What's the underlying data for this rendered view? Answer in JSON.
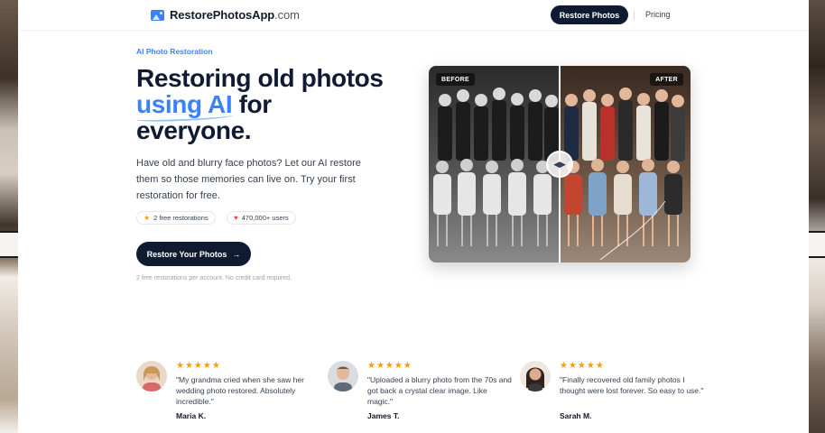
{
  "header": {
    "logo_name": "RestorePhotosApp",
    "logo_domain": ".com",
    "logo_icon": "photo-icon",
    "nav_button": "Restore Photos",
    "nav_link": "Pricing"
  },
  "hero": {
    "eyebrow": "AI Photo Restoration",
    "headline_line1": "Restoring old photos",
    "headline_accent": "using AI",
    "headline_line2_rest": " for",
    "headline_line3": "everyone.",
    "description": "Have old and blurry face photos? Let our AI restore them so those memories can live on. Try your first restoration for free.",
    "badge_restorations": "2 free restorations",
    "badge_users": "470,000+ users",
    "cta_label": "Restore Your Photos",
    "cta_arrow": "→",
    "fineprint": "2 free restorations per account. No credit card required."
  },
  "compare": {
    "before_label": "BEFORE",
    "after_label": "AFTER",
    "handle_icon": "compare-arrows-icon",
    "handle_glyph": "◀▶"
  },
  "testimonials": [
    {
      "stars": "★★★★★",
      "quote": "\"My grandma cried when she saw her wedding photo restored. Absolutely incredible.\"",
      "author": "Maria K."
    },
    {
      "stars": "★★★★★",
      "quote": "\"Uploaded a blurry photo from the 70s and got back a crystal clear image. Like magic.\"",
      "author": "James T."
    },
    {
      "stars": "★★★★★",
      "quote": "\"Finally recovered old family photos I thought were lost forever. So easy to use.\"",
      "author": "Sarah M."
    }
  ],
  "colors": {
    "brand_dark": "#0f1b33",
    "accent_blue": "#3b82f6",
    "star_gold": "#f59e0b",
    "heart_red": "#ef4444"
  }
}
